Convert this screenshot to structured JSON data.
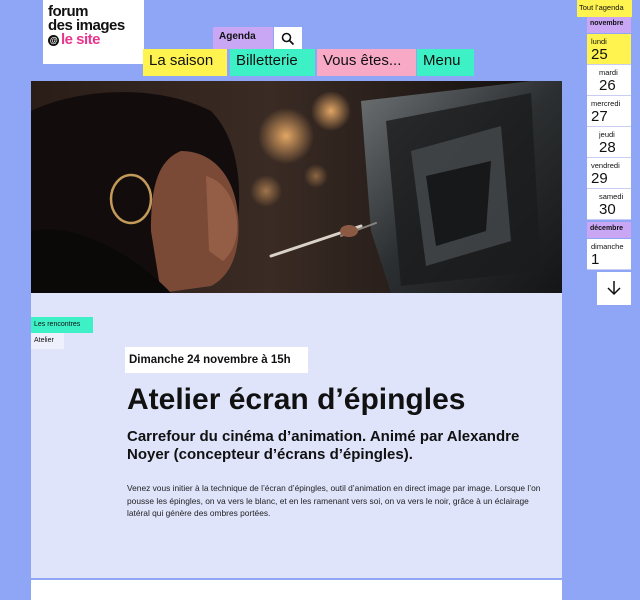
{
  "logo": {
    "line1": "forum",
    "line2": "des images",
    "at_symbol": "@",
    "line3": "le site"
  },
  "header": {
    "agenda_label": "Agenda",
    "search_icon": "search-icon",
    "nav": [
      {
        "label": "La saison",
        "color": "#fff44f"
      },
      {
        "label": "Billetterie",
        "color": "#3df0c5"
      },
      {
        "label": "Vous êtes...",
        "color": "#f7a9c6"
      },
      {
        "label": "Menu",
        "color": "#3df0c5"
      }
    ]
  },
  "event": {
    "tags": [
      "Les rencontres",
      "Atelier"
    ],
    "date": "Dimanche 24 novembre à 15h",
    "title": "Atelier écran d’épingles",
    "subtitle": "Carrefour du cinéma d’animation. Animé par Alexandre Noyer (concepteur d’écrans d’épingles).",
    "description": "Venez vous initier à la technique de l’écran d’épingles, outil d’animation en direct image par image. Lorsque l’on pousse les épingles, on va vers le blanc, et en les ramenant vers soi, on va vers le noir, grâce à un éclairage latéral qui génère des ombres portées."
  },
  "agenda": {
    "header": "Tout l’agenda",
    "months": [
      {
        "name": "novembre",
        "days": [
          {
            "name": "lundi",
            "num": "25",
            "active": true
          },
          {
            "name": "mardi",
            "num": "26"
          },
          {
            "name": "mercredi",
            "num": "27"
          },
          {
            "name": "jeudi",
            "num": "28"
          },
          {
            "name": "vendredi",
            "num": "29"
          },
          {
            "name": "samedi",
            "num": "30"
          }
        ]
      },
      {
        "name": "décembre",
        "days": [
          {
            "name": "dimanche",
            "num": "1"
          }
        ]
      }
    ],
    "down_icon": "arrow-down-icon"
  },
  "colors": {
    "background": "#8fa6f6",
    "yellow": "#fff44f",
    "mint": "#3df0c5",
    "pink": "#f7a9c6",
    "lavender": "#c9a7f5",
    "logo_accent": "#e8358d",
    "content_bg": "#dfe4fb"
  }
}
